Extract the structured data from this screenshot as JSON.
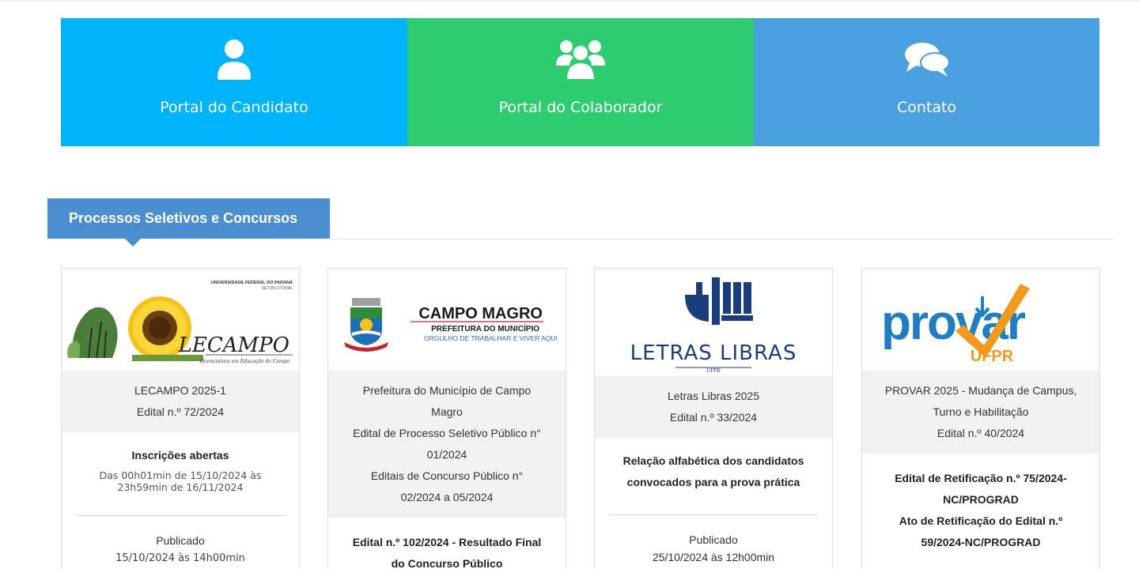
{
  "portals": [
    {
      "label": "Portal do Candidato",
      "icon": "user-icon",
      "color": "#00b4fb"
    },
    {
      "label": "Portal do Colaborador",
      "icon": "users-group-icon",
      "color": "#2ecc71"
    },
    {
      "label": "Contato",
      "icon": "chat-bubbles-icon",
      "color": "#4aa0df"
    }
  ],
  "section": {
    "title": "Processos Seletivos e Concursos",
    "color": "#4a8ed0"
  },
  "cards": [
    {
      "logo": {
        "top_text": "UNIVERSIDADE FEDERAL DO PARANÁ",
        "sub_text": "SETOR LITORAL",
        "name": "LECAMPO",
        "tagline": "Licenciatura em Educação do Campo"
      },
      "title_lines": [
        "LECAMPO 2025-1",
        "Edital n.º 72/2024"
      ],
      "headline": "Inscrições abertas",
      "detail": "Das 00h01min de 15/10/2024 às 23h59min de 16/11/2024",
      "published_label": "Publicado",
      "published_value": "15/10/2024 às 14h00min"
    },
    {
      "logo": {
        "name": "CAMPO MAGRO",
        "line2": "PREFEITURA DO MUNICÍPIO",
        "line3": "ORGULHO DE TRABALHAR E VIVER AQUI"
      },
      "title_lines": [
        "Prefeitura do Município de Campo",
        "Magro",
        "Edital de Processo Seletivo Público n°",
        "01/2024",
        "Editais de Concurso Público n°",
        "02/2024 a 05/2024"
      ],
      "headline_lines": [
        "Edital n.º 102/2024 - Resultado Final",
        "do Concurso Público"
      ]
    },
    {
      "logo": {
        "name": "LETRAS LIBRAS",
        "sub": "UFPR"
      },
      "title_lines": [
        "Letras Libras 2025",
        "Edital n.º 33/2024"
      ],
      "headline_lines": [
        "Relação alfabética dos candidatos",
        "convocados para a prova prática"
      ],
      "published_label": "Publicado",
      "published_value": "25/10/2024 às 12h00min"
    },
    {
      "logo": {
        "name": "provar",
        "sub": "UFPR"
      },
      "title_lines": [
        "PROVAR 2025 - Mudança de Campus,",
        "Turno e Habilitação",
        "Edital n.º 40/2024"
      ],
      "headline_lines": [
        "Edital de Retificação n.º 75/2024-",
        "NC/PROGRAD",
        "Ato de Retificação do Edital n.º",
        "59/2024-NC/PROGRAD"
      ]
    }
  ]
}
